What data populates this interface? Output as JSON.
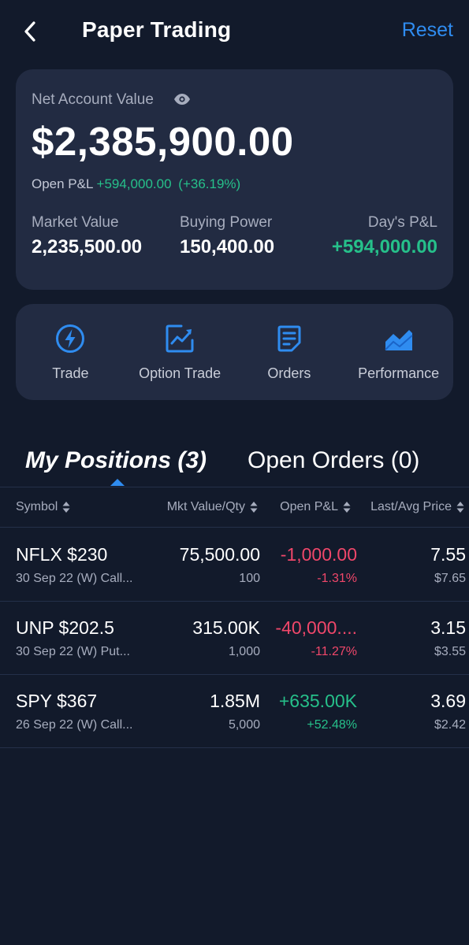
{
  "header": {
    "title": "Paper Trading",
    "reset_label": "Reset"
  },
  "account": {
    "net_label": "Net Account Value",
    "net_value": "$2,385,900.00",
    "open_pl_label": "Open P&L",
    "open_pl_value": "+594,000.00",
    "open_pl_pct": "(+36.19%)",
    "market_value_label": "Market Value",
    "market_value": "2,235,500.00",
    "buying_power_label": "Buying Power",
    "buying_power": "150,400.00",
    "days_pl_label": "Day's P&L",
    "days_pl": "+594,000.00"
  },
  "actions": [
    {
      "label": "Trade",
      "icon": "lightning-icon"
    },
    {
      "label": "Option Trade",
      "icon": "chart-frame-icon"
    },
    {
      "label": "Orders",
      "icon": "document-icon"
    },
    {
      "label": "Performance",
      "icon": "area-chart-icon"
    }
  ],
  "tabs": {
    "positions": "My Positions (3)",
    "orders": "Open Orders (0)"
  },
  "columns": {
    "symbol": "Symbol",
    "mkt_value": "Mkt Value/Qty",
    "open_pl": "Open P&L",
    "last_avg": "Last/Avg Price"
  },
  "positions": [
    {
      "symbol": "NFLX $230",
      "desc": "30 Sep 22 (W) Call...",
      "mkt_value": "75,500.00",
      "qty": "100",
      "pl": "-1,000.00",
      "pl_pct": "-1.31%",
      "last": "7.55",
      "avg": "$7.65"
    },
    {
      "symbol": "UNP $202.5",
      "desc": "30 Sep 22 (W) Put...",
      "mkt_value": "315.00K",
      "qty": "1,000",
      "pl": "-40,000....",
      "pl_pct": "-11.27%",
      "last": "3.15",
      "avg": "$3.55"
    },
    {
      "symbol": "SPY $367",
      "desc": "26 Sep 22 (W) Call...",
      "mkt_value": "1.85M",
      "qty": "5,000",
      "pl": "+635.00K",
      "pl_pct": "+52.48%",
      "last": "3.69",
      "avg": "$2.42"
    }
  ],
  "colors": {
    "background": "#121a2b",
    "card": "#222b42",
    "accent": "#2f8cf0",
    "positive": "#26c08a",
    "negative": "#f0476a"
  }
}
